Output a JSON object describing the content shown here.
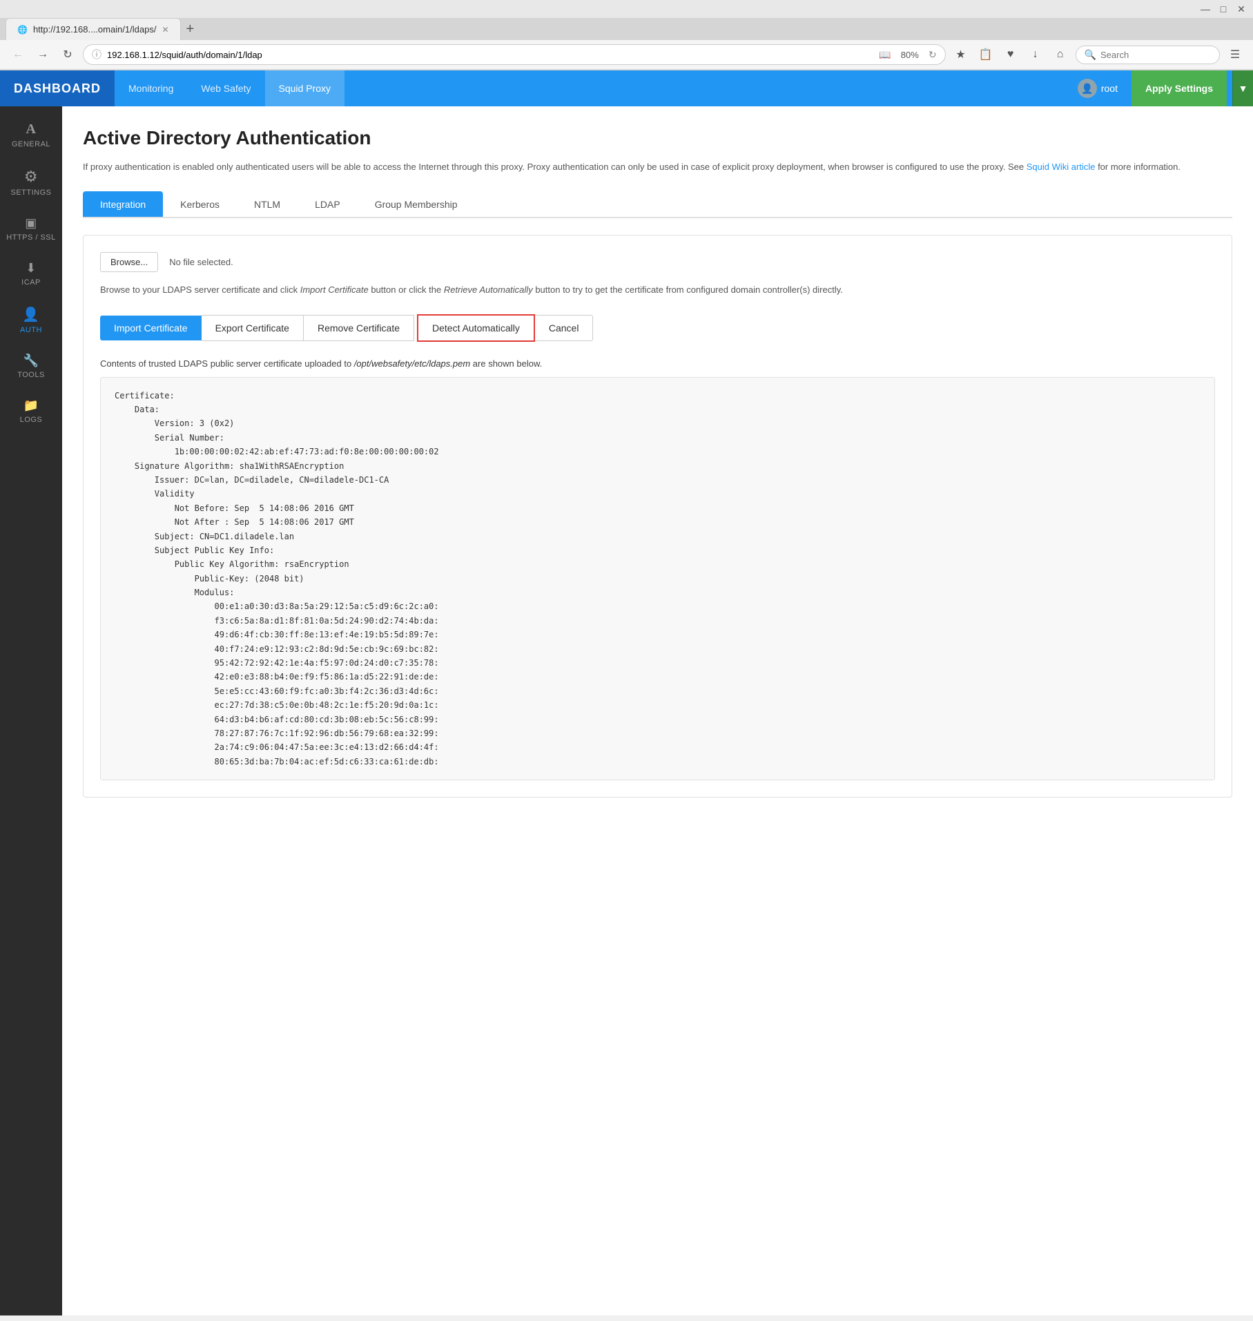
{
  "browser": {
    "tab_url": "http://192.168....omain/1/ldaps/",
    "address": "192.168.1.12/squid/auth/domain/1/ldap",
    "zoom": "80%",
    "search_placeholder": "Search"
  },
  "header": {
    "logo": "DASHBOARD",
    "nav": [
      {
        "label": "Monitoring",
        "active": false
      },
      {
        "label": "Web Safety",
        "active": false
      },
      {
        "label": "Squid Proxy",
        "active": true
      }
    ],
    "user": "root",
    "apply_button": "Apply Settings"
  },
  "sidebar": {
    "items": [
      {
        "id": "general",
        "label": "General",
        "icon": "A",
        "active": false
      },
      {
        "id": "settings",
        "label": "Settings",
        "icon": "⚙",
        "active": false
      },
      {
        "id": "https-ssl",
        "label": "HTTPS / SSL",
        "icon": "⬜",
        "active": false
      },
      {
        "id": "icap",
        "label": "ICAP",
        "icon": "📥",
        "active": false
      },
      {
        "id": "auth",
        "label": "Auth",
        "icon": "👤",
        "active": true
      },
      {
        "id": "tools",
        "label": "Tools",
        "icon": "🔧",
        "active": false
      },
      {
        "id": "logs",
        "label": "Logs",
        "icon": "📁",
        "active": false
      }
    ]
  },
  "page": {
    "title": "Active Directory Authentication",
    "description_part1": "If proxy authentication is enabled only authenticated users will be able to access the Internet through this proxy. Proxy authentication can only be used in case of explicit proxy deployment, when browser is configured to use the proxy. See ",
    "description_link": "Squid Wiki article",
    "description_part2": " for more information.",
    "tabs": [
      {
        "label": "Integration",
        "active": true
      },
      {
        "label": "Kerberos",
        "active": false
      },
      {
        "label": "NTLM",
        "active": false
      },
      {
        "label": "LDAP",
        "active": false
      },
      {
        "label": "Group Membership",
        "active": false
      }
    ],
    "browse_btn": "Browse...",
    "no_file": "No file selected.",
    "browse_desc_part1": "Browse to your LDAPS server certificate and click ",
    "browse_desc_italic1": "Import Certificate",
    "browse_desc_part2": " button or click the ",
    "browse_desc_italic2": "Retrieve Automatically",
    "browse_desc_part3": " button to try to get the certificate from configured domain controller(s) directly.",
    "btn_import": "Import Certificate",
    "btn_export": "Export Certificate",
    "btn_remove": "Remove Certificate",
    "btn_detect": "Detect Automatically",
    "btn_cancel": "Cancel",
    "cert_info_part1": "Contents of trusted LDAPS public server certificate uploaded to ",
    "cert_info_path": "/opt/websafety/etc/ldaps.pem",
    "cert_info_part2": " are shown below.",
    "cert_content": "Certificate:\n    Data:\n        Version: 3 (0x2)\n        Serial Number:\n            1b:00:00:00:02:42:ab:ef:47:73:ad:f0:8e:00:00:00:00:02\n    Signature Algorithm: sha1WithRSAEncryption\n        Issuer: DC=lan, DC=diladele, CN=diladele-DC1-CA\n        Validity\n            Not Before: Sep  5 14:08:06 2016 GMT\n            Not After : Sep  5 14:08:06 2017 GMT\n        Subject: CN=DC1.diladele.lan\n        Subject Public Key Info:\n            Public Key Algorithm: rsaEncryption\n                Public-Key: (2048 bit)\n                Modulus:\n                    00:e1:a0:30:d3:8a:5a:29:12:5a:c5:d9:6c:2c:a0:\n                    f3:c6:5a:8a:d1:8f:81:0a:5d:24:90:d2:74:4b:da:\n                    49:d6:4f:cb:30:ff:8e:13:ef:4e:19:b5:5d:89:7e:\n                    40:f7:24:e9:12:93:c2:8d:9d:5e:cb:9c:69:bc:82:\n                    95:42:72:92:42:1e:4a:f5:97:0d:24:d0:c7:35:78:\n                    42:e0:e3:88:b4:0e:f9:f5:86:1a:d5:22:91:de:de:\n                    5e:e5:cc:43:60:f9:fc:a0:3b:f4:2c:36:d3:4d:6c:\n                    ec:27:7d:38:c5:0e:0b:48:2c:1e:f5:20:9d:0a:1c:\n                    64:d3:b4:b6:af:cd:80:cd:3b:08:eb:5c:56:c8:99:\n                    78:27:87:76:7c:1f:92:96:db:56:79:68:ea:32:99:\n                    2a:74:c9:06:04:47:5a:ee:3c:e4:13:d2:66:d4:4f:\n                    80:65:3d:ba:7b:04:ac:ef:5d:c6:33:ca:61:de:db:"
  }
}
